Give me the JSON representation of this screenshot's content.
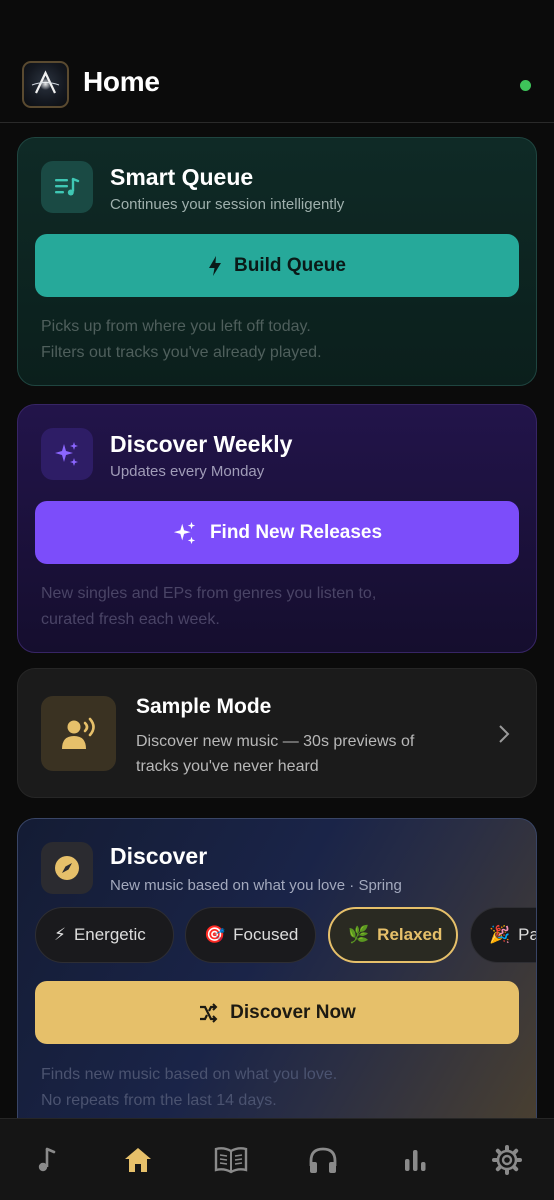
{
  "header": {
    "title": "Home"
  },
  "smart_queue": {
    "title": "Smart Queue",
    "subtitle": "Continues your session intelligently",
    "button": "Build Queue",
    "desc1": "Picks up from where you left off today.",
    "desc2": "Filters out tracks you've already played."
  },
  "discover_weekly": {
    "title": "Discover Weekly",
    "subtitle": "Updates every Monday",
    "button": "Find New Releases",
    "desc1": "New singles and EPs from genres you listen to,",
    "desc2": "curated fresh each week."
  },
  "sample_mode": {
    "title": "Sample Mode",
    "desc1": "Discover new music — 30s previews of",
    "desc2": "tracks you've never heard"
  },
  "discover": {
    "title": "Discover",
    "subtitle": "New music based on what you love · Spring",
    "moods": [
      {
        "emoji": "⚡",
        "label": "Energetic"
      },
      {
        "emoji": "🎯",
        "label": "Focused"
      },
      {
        "emoji": "🌿",
        "label": "Relaxed",
        "selected": true
      },
      {
        "emoji": "🎉",
        "label": "Party"
      }
    ],
    "button": "Discover Now",
    "desc1": "Finds new music based on what you love.",
    "desc2": "No repeats from the last 14 days."
  },
  "tabbar": {
    "active": "home",
    "tabs": [
      "music-note-icon",
      "home-icon",
      "library-icon",
      "headphones-icon",
      "stats-icon",
      "settings-icon"
    ]
  },
  "colors": {
    "teal": "#26a99a",
    "purple": "#7c4dfa",
    "gold": "#e6c06a",
    "status_green": "#3ec45a"
  }
}
